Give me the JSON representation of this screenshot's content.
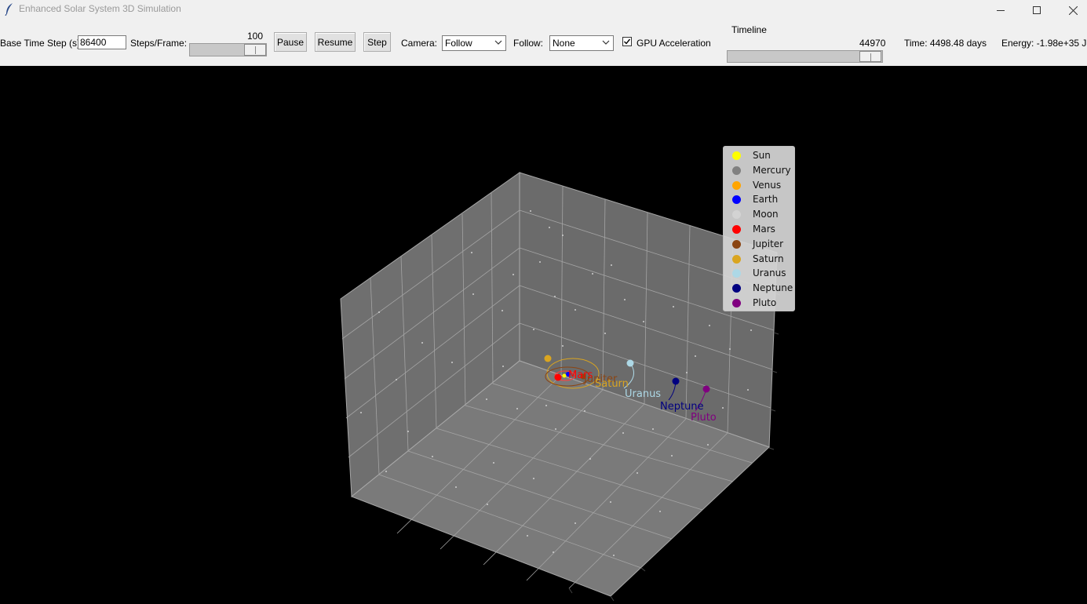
{
  "window": {
    "title": "Enhanced Solar System 3D Simulation",
    "minimize_icon": "minimize-icon",
    "maximize_icon": "maximize-icon",
    "close_icon": "close-icon"
  },
  "toolbar": {
    "base_time_step_label": "Base Time Step (s):",
    "base_time_step_value": "86400",
    "steps_per_frame_label": "Steps/Frame:",
    "steps_per_frame_value": "100",
    "pause_label": "Pause",
    "resume_label": "Resume",
    "step_label": "Step",
    "camera_label": "Camera:",
    "camera_value": "Follow",
    "follow_label": "Follow:",
    "follow_value": "None",
    "gpu_label": "GPU Acceleration",
    "gpu_checked": true,
    "timeline_label": "Timeline",
    "timeline_value": "44970",
    "time_text": "Time: 4498.48 days",
    "energy_text": "Energy: -1.98e+35 J"
  },
  "legend": [
    {
      "name": "Sun",
      "color": "#ffff00"
    },
    {
      "name": "Mercury",
      "color": "#808080"
    },
    {
      "name": "Venus",
      "color": "#ffa500"
    },
    {
      "name": "Earth",
      "color": "#0000ff"
    },
    {
      "name": "Moon",
      "color": "#d3d3d3"
    },
    {
      "name": "Mars",
      "color": "#ff0000"
    },
    {
      "name": "Jupiter",
      "color": "#8b4513"
    },
    {
      "name": "Saturn",
      "color": "#daa520"
    },
    {
      "name": "Uranus",
      "color": "#add8e6"
    },
    {
      "name": "Neptune",
      "color": "#000080"
    },
    {
      "name": "Pluto",
      "color": "#800080"
    }
  ],
  "plot_labels": {
    "mars": "Mars",
    "jupiter": "Jupiter",
    "saturn": "Saturn",
    "uranus": "Uranus",
    "neptune": "Neptune",
    "pluto": "Pluto"
  }
}
